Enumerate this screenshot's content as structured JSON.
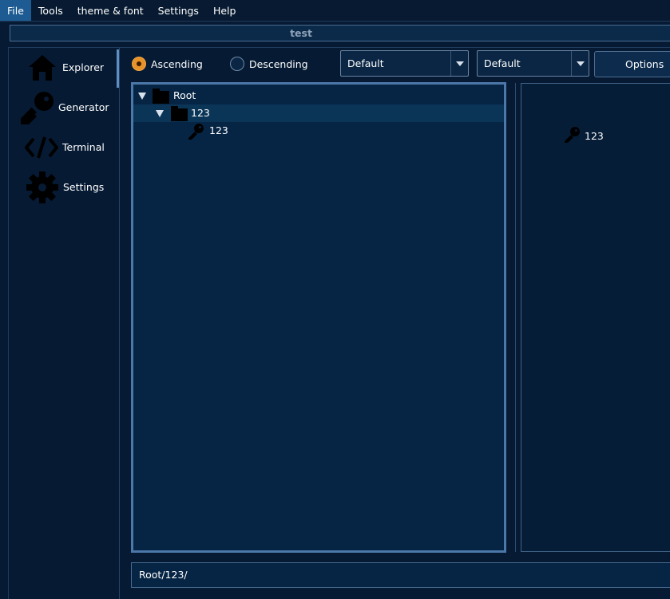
{
  "menu": {
    "items": [
      "File",
      "Tools",
      "theme & font",
      "Settings",
      "Help"
    ]
  },
  "window": {
    "title": "test"
  },
  "sidebar": {
    "items": [
      {
        "label": "Explorer",
        "icon": "home-icon"
      },
      {
        "label": "Generator",
        "icon": "key-icon"
      },
      {
        "label": "Terminal",
        "icon": "code-icon"
      },
      {
        "label": "Settings",
        "icon": "gear-icon"
      }
    ]
  },
  "toolbar": {
    "sort_ascending_label": "Ascending",
    "sort_descending_label": "Descending",
    "sort_selected": "Ascending",
    "combo1_value": "Default",
    "combo2_value": "Default",
    "options_label": "Options"
  },
  "tree": {
    "nodes": [
      {
        "label": "Root",
        "type": "folder",
        "expanded": true,
        "depth": 0
      },
      {
        "label": "123",
        "type": "folder",
        "expanded": true,
        "depth": 1,
        "selected": true
      },
      {
        "label": "123",
        "type": "key",
        "depth": 2
      }
    ]
  },
  "detail": {
    "items": [
      {
        "label": "123",
        "icon": "key-icon"
      }
    ]
  },
  "path_bar": {
    "value": "Root/123/"
  },
  "colors": {
    "background": "#061a33",
    "panel": "#062544",
    "accent_border": "#4c78a9",
    "radio_selected": "#e8932a",
    "menu_active": "#1d5b92"
  }
}
